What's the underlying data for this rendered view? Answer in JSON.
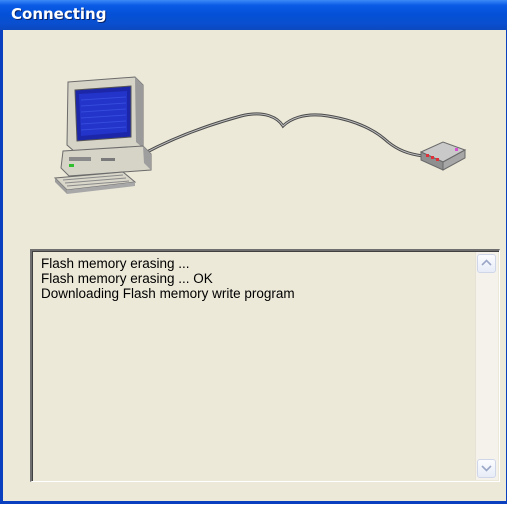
{
  "window": {
    "title": "Connecting"
  },
  "illustration": {
    "computer_icon": "computer-icon",
    "device_icon": "usb-device-icon",
    "cable_icon": "cable-icon"
  },
  "log": {
    "lines": [
      "Flash memory erasing ...",
      "Flash memory erasing ... OK",
      "Downloading Flash memory write program"
    ]
  },
  "colors": {
    "titlebar": "#0450d6",
    "window_bg": "#ece9d8",
    "border": "#0a3fbf"
  }
}
